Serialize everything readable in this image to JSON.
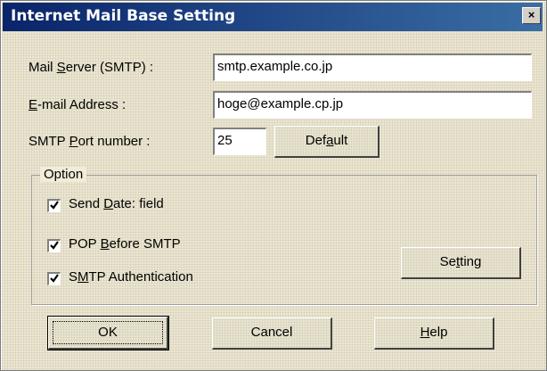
{
  "window": {
    "title": "Internet Mail Base Setting",
    "close_glyph": "×"
  },
  "fields": {
    "mail_server": {
      "label_pre": "Mail ",
      "label_key": "S",
      "label_post": "erver (SMTP) :",
      "value": "smtp.example.co.jp"
    },
    "email": {
      "label_pre": "",
      "label_key": "E",
      "label_post": "-mail Address :",
      "value": "hoge@example.cp.jp"
    },
    "port": {
      "label_pre": "SMTP ",
      "label_key": "P",
      "label_post": "ort number :",
      "value": "25"
    }
  },
  "buttons": {
    "default": {
      "pre": "Def",
      "key": "a",
      "post": "ult"
    },
    "setting": {
      "pre": "Se",
      "key": "t",
      "post": "ting"
    },
    "ok": {
      "label": "OK"
    },
    "cancel": {
      "label": "Cancel"
    },
    "help": {
      "pre": "",
      "key": "H",
      "post": "elp"
    }
  },
  "option_group": {
    "label": "Option",
    "send_date": {
      "pre": "Send ",
      "key": "D",
      "post": "ate: field",
      "checked": true
    },
    "pop_before_smtp": {
      "pre": "POP ",
      "key": "B",
      "post": "efore SMTP",
      "checked": true
    },
    "smtp_auth": {
      "pre": "S",
      "key": "M",
      "post": "TP Authentication",
      "checked": true
    }
  }
}
